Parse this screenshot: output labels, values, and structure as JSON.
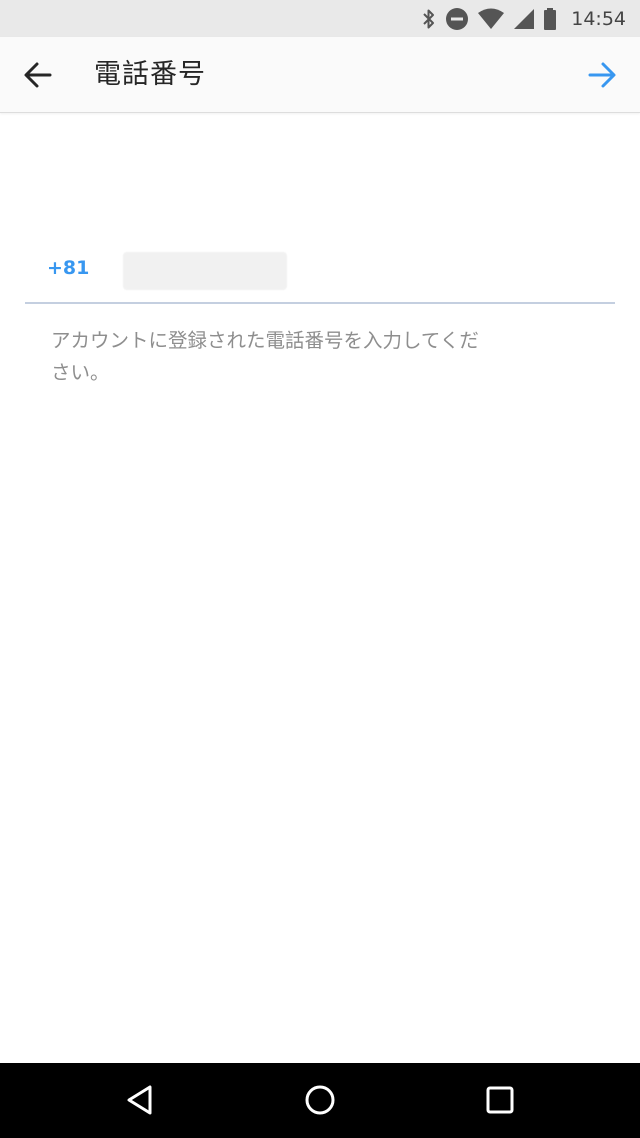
{
  "status_bar": {
    "time": "14:54",
    "icons": [
      "bluetooth-icon",
      "do-not-disturb-icon",
      "wifi-icon",
      "cell-signal-icon",
      "battery-icon"
    ]
  },
  "header": {
    "title": "電話番号",
    "back_icon": "arrow-left-icon",
    "next_icon": "arrow-right-icon"
  },
  "phone": {
    "country_code": "+81",
    "value": ""
  },
  "helper_text": "アカウントに登録された電話番号を入力してください。",
  "colors": {
    "accent": "#3897f0",
    "underline": "#c4cfe0",
    "helper": "#8e8e8e",
    "title": "#262626",
    "status_bar": "#e9e9e9",
    "nav_bar": "#000000"
  },
  "nav_bar": {
    "icons": [
      "triangle-back-icon",
      "circle-home-icon",
      "square-recents-icon"
    ]
  }
}
